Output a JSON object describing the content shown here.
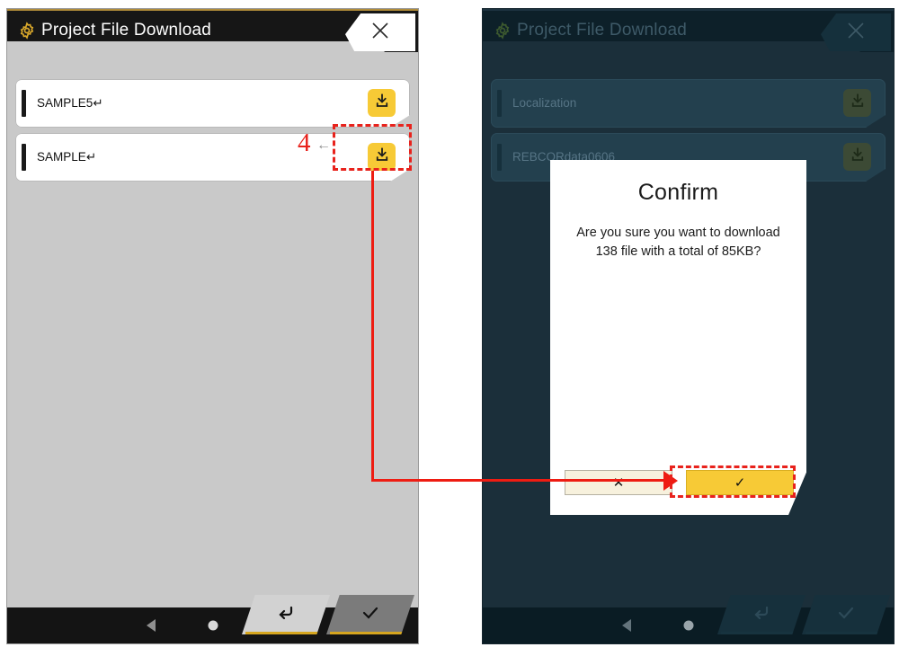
{
  "left_panel": {
    "titlebar": {
      "gear_icon": "gear-icon",
      "title": "Project File Download",
      "close_icon": "close-icon"
    },
    "files": [
      {
        "name": "SAMPLE5↵",
        "download_icon": "download-icon"
      },
      {
        "name": "SAMPLE↵",
        "download_icon": "download-icon"
      }
    ],
    "navbar": {
      "back_icon": "android-back-icon",
      "home_icon": "android-home-icon",
      "recent_icon": "android-recents-icon"
    },
    "actions": [
      {
        "icon": "return-arrow-icon",
        "name": "back-action-button"
      },
      {
        "icon": "check-icon",
        "name": "confirm-action-button"
      }
    ]
  },
  "right_panel": {
    "titlebar": {
      "gear_icon": "gear-icon",
      "title": "Project File Download",
      "close_icon": "close-icon"
    },
    "files": [
      {
        "name": "Localization",
        "download_icon": "download-icon"
      },
      {
        "name": "REBCORdata0606",
        "download_icon": "download-icon"
      }
    ],
    "navbar": {
      "back_icon": "android-back-icon",
      "home_icon": "android-home-icon",
      "recent_icon": "android-recents-icon"
    },
    "actions": [
      {
        "icon": "return-arrow-icon",
        "name": "back-action-button"
      },
      {
        "icon": "check-icon",
        "name": "confirm-action-button"
      }
    ]
  },
  "dialog": {
    "title": "Confirm",
    "message": "Are you sure you want to download 138 file with a total of 85KB?",
    "cancel_label": "✕",
    "ok_label": "✓"
  },
  "annotations": {
    "step_number": "4",
    "pointer_glyph": "←",
    "highlight_color": "#ee1c12"
  },
  "colors": {
    "accent_yellow": "#f7ca36",
    "gold_line": "#b08c3a",
    "annotation_red": "#ee1c12",
    "panel_bg": "#c9c9c9",
    "dim_bg": "#1b2f3a"
  }
}
